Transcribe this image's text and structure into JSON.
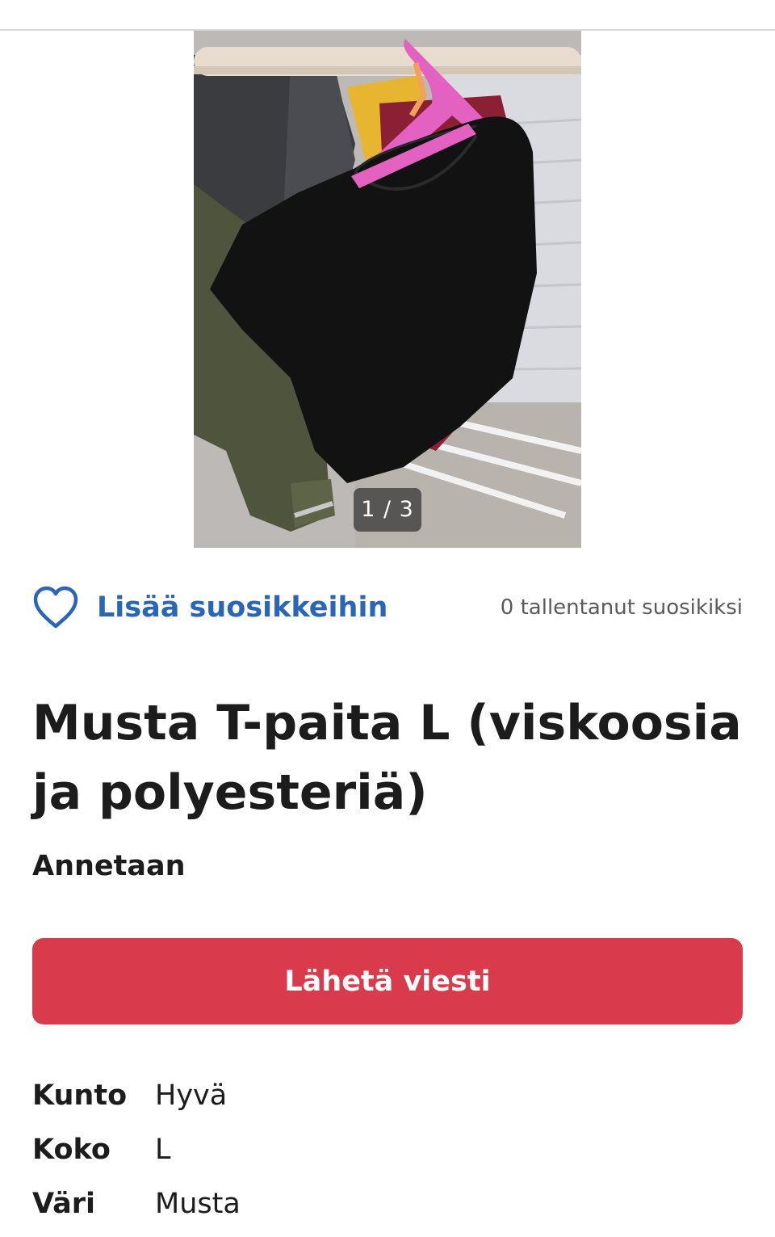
{
  "listing": {
    "image_counter": "1 / 3",
    "favorite_label": "Lisää suosikkeihin",
    "favorite_count": "0 tallentanut suosikiksi",
    "title": "Musta T-paita L (viskoosia ja polyesteriä)",
    "price": "Annetaan",
    "send_button": "Lähetä viesti",
    "details": [
      {
        "key": "Kunto",
        "value": "Hyvä"
      },
      {
        "key": "Koko",
        "value": "L"
      },
      {
        "key": "Väri",
        "value": "Musta"
      }
    ]
  },
  "colors": {
    "accent_blue": "#2a66b5",
    "button_red": "#d93a4c"
  },
  "icons": {
    "favorite": "heart-outline-icon"
  }
}
